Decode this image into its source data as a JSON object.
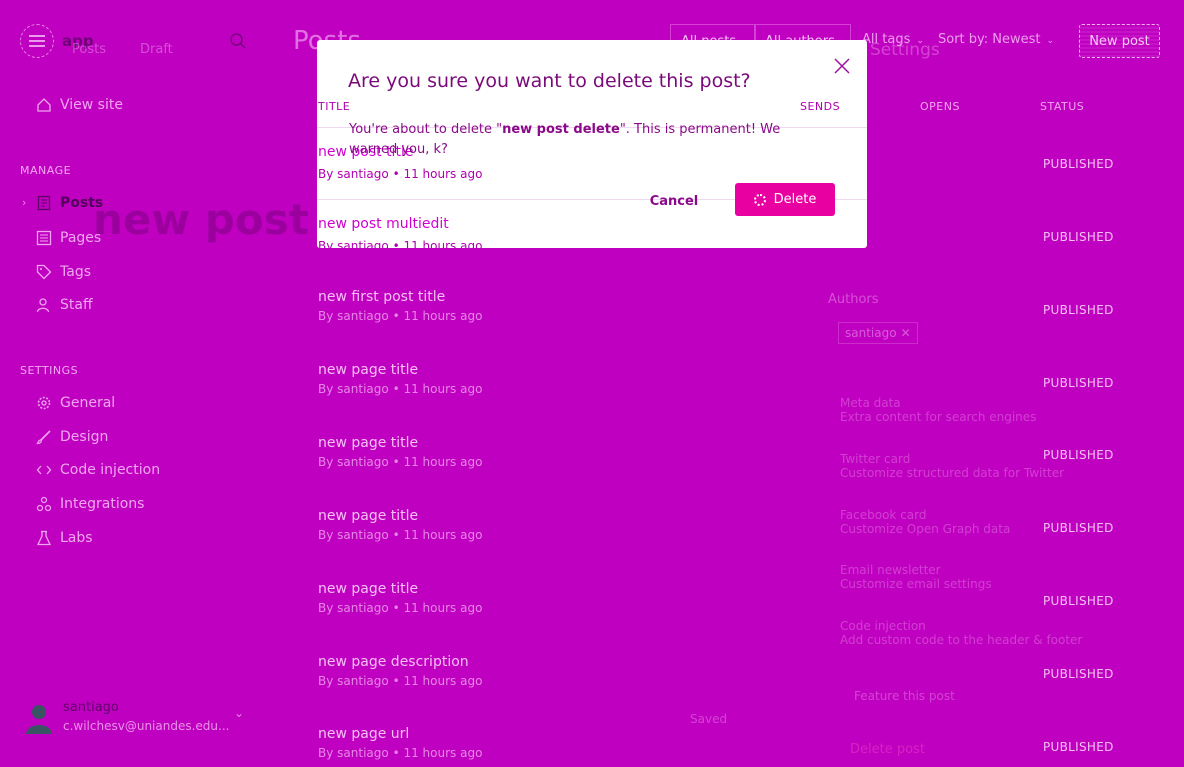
{
  "header": {
    "app_name": "app",
    "page_title": "Posts",
    "bg_posts_label": "Posts",
    "bg_draft_label": "Draft",
    "settings_label": "Settings",
    "new_post_label": "New post",
    "filters": {
      "all_posts": "All posts",
      "all_authors": "All authors",
      "all_tags": "All tags",
      "sort": "Sort by: Newest"
    }
  },
  "sidebar": {
    "view_site": "View site",
    "manage_label": "MANAGE",
    "manage_items": [
      {
        "label": "Posts"
      },
      {
        "label": "Pages"
      },
      {
        "label": "Tags"
      },
      {
        "label": "Staff"
      }
    ],
    "settings_label": "SETTINGS",
    "settings_items": [
      {
        "label": "General"
      },
      {
        "label": "Design"
      },
      {
        "label": "Code injection"
      },
      {
        "label": "Integrations"
      },
      {
        "label": "Labs"
      }
    ],
    "user": {
      "name": "santiago",
      "email": "c.wilchesv@uniandes.edu..."
    }
  },
  "background": {
    "editor_title": "new post d",
    "authors_label": "Authors",
    "author_chip": "santiago",
    "settings_rows": [
      {
        "title": "Meta data",
        "sub": "Extra content for search engines"
      },
      {
        "title": "Twitter card",
        "sub": "Customize structured data for Twitter"
      },
      {
        "title": "Facebook card",
        "sub": "Customize Open Graph data"
      },
      {
        "title": "Email newsletter",
        "sub": "Customize email settings"
      },
      {
        "title": "Code injection",
        "sub": "Add custom code to the header & footer"
      }
    ],
    "feature_post": "Feature this post",
    "delete_post": "Delete post",
    "saved": "Saved"
  },
  "table": {
    "col_title": "TITLE",
    "col_sends": "SENDS",
    "col_opens": "OPENS",
    "col_status": "STATUS",
    "rows": [
      {
        "title": "new post title",
        "author": "santiago",
        "time": "11 hours ago",
        "status": "PUBLISHED"
      },
      {
        "title": "new post multiedit",
        "author": "santiago",
        "time": "11 hours ago",
        "status": "PUBLISHED"
      },
      {
        "title": "new first post title",
        "author": "santiago",
        "time": "11 hours ago",
        "status": "PUBLISHED"
      },
      {
        "title": "new page title",
        "author": "santiago",
        "time": "11 hours ago",
        "status": "PUBLISHED"
      },
      {
        "title": "new page title",
        "author": "santiago",
        "time": "11 hours ago",
        "status": "PUBLISHED"
      },
      {
        "title": "new page title",
        "author": "santiago",
        "time": "11 hours ago",
        "status": "PUBLISHED"
      },
      {
        "title": "new page title",
        "author": "santiago",
        "time": "11 hours ago",
        "status": "PUBLISHED"
      },
      {
        "title": "new page description",
        "author": "santiago",
        "time": "11 hours ago",
        "status": "PUBLISHED"
      },
      {
        "title": "new page url",
        "author": "santiago",
        "time": "11 hours ago",
        "status": "PUBLISHED"
      }
    ],
    "by_prefix": "By",
    "dot": "•"
  },
  "modal": {
    "title": "Are you sure you want to delete this post?",
    "body_prefix": "You're about to delete \"",
    "body_bold": "new post delete",
    "body_suffix": "\". This is permanent! We warned you, k?",
    "cancel_label": "Cancel",
    "delete_label": "Delete"
  },
  "colors": {
    "overlay": "#c000c0",
    "accent": "#e800a0",
    "modal_bg": "#ffffff"
  }
}
